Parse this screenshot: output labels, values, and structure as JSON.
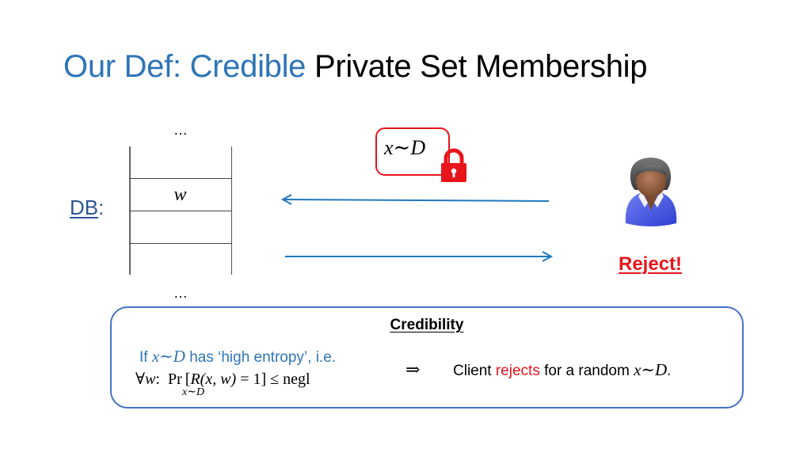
{
  "slide": {
    "title": {
      "accent_part": "Our Def: Credible",
      "rest_part": "Private Set Membership"
    },
    "colors": {
      "accent_blue": "#2e75b6",
      "db_label_blue": "#2f5597",
      "arrow_blue": "#1f78c1",
      "alert_red": "#e8141c",
      "box_border": "#4472c4"
    },
    "database": {
      "label": "DB",
      "label_suffix": ":",
      "ellipsis_top": "…",
      "ellipsis_bottom": "…",
      "rows": [
        "",
        "w",
        "",
        ""
      ]
    },
    "query": {
      "text": "x∼D",
      "lock_icon": "padlock-icon"
    },
    "arrows": [
      {
        "direction": "client-to-server",
        "label": ""
      },
      {
        "direction": "server-to-client",
        "label": ""
      }
    ],
    "client": {
      "avatar_icon": "user-avatar-icon",
      "result": "Reject!"
    },
    "credibility": {
      "heading": "Credibility",
      "hypothesis_prefix": "If ",
      "hypothesis_math": "x∼D",
      "hypothesis_suffix": " has ‘high entropy’, i.e.",
      "formula": "∀w:  Pr [R(x, w) = 1] ≤ negl",
      "formula_parts": {
        "forall": "∀",
        "var_w": "w",
        "colon": ":",
        "pr": "Pr",
        "bracket_expr_R": "R",
        "bracket_expr_args": "(x, w)",
        "equals": " = 1]",
        "leq": " ≤ ",
        "negl": "negl"
      },
      "subscript": "x∼D",
      "implies": "⇒",
      "conclusion_prefix": "Client ",
      "conclusion_highlight": "rejects",
      "conclusion_suffix": " for a random ",
      "conclusion_math": "x∼D",
      "conclusion_end": "."
    }
  }
}
